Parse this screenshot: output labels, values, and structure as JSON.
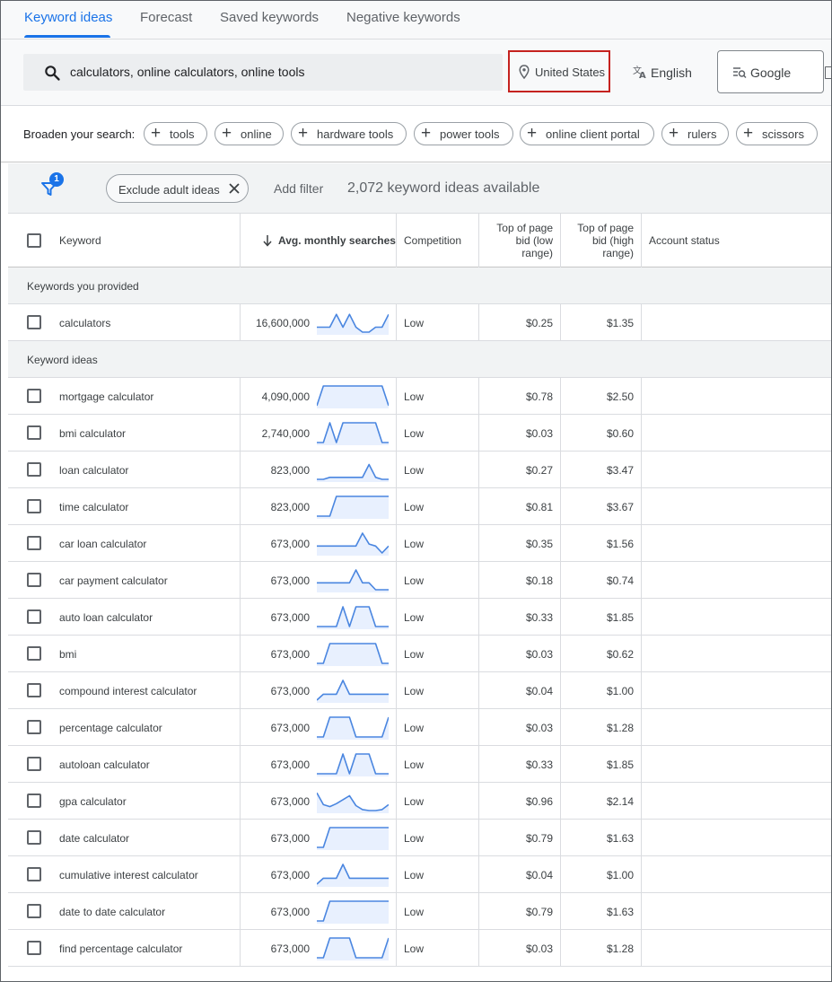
{
  "tabs": [
    {
      "label": "Keyword ideas",
      "active": true
    },
    {
      "label": "Forecast",
      "active": false
    },
    {
      "label": "Saved keywords",
      "active": false
    },
    {
      "label": "Negative keywords",
      "active": false
    }
  ],
  "search": {
    "query": "calculators, online calculators, online tools",
    "location": "United States",
    "language": "English",
    "network": "Google"
  },
  "broaden": {
    "label": "Broaden your search:",
    "chips": [
      "tools",
      "online",
      "hardware tools",
      "power tools",
      "online client portal",
      "rulers",
      "scissors"
    ]
  },
  "filters": {
    "badge_count": "1",
    "adult_chip": "Exclude adult ideas",
    "add_filter": "Add filter",
    "available_text": "2,072 keyword ideas available"
  },
  "columns": {
    "keyword": "Keyword",
    "avg": "Avg. monthly searches",
    "competition": "Competition",
    "bid_low": "Top of page bid (low range)",
    "bid_high": "Top of page bid (high range)",
    "account_status": "Account status"
  },
  "sections": {
    "provided": "Keywords you provided",
    "ideas": "Keyword ideas"
  },
  "provided_rows": [
    {
      "keyword": "calculators",
      "searches": "16,600,000",
      "competition": "Low",
      "low": "$0.25",
      "high": "$1.35",
      "trend": [
        0.25,
        0.25,
        0.25,
        0.9,
        0.25,
        0.9,
        0.25,
        0.0,
        0.0,
        0.25,
        0.25,
        0.9
      ]
    }
  ],
  "idea_rows": [
    {
      "keyword": "mortgage calculator",
      "searches": "4,090,000",
      "competition": "Low",
      "low": "$0.78",
      "high": "$2.50",
      "trend": [
        0,
        1,
        1,
        1,
        1,
        1,
        1,
        1,
        1,
        1,
        1,
        0
      ]
    },
    {
      "keyword": "bmi calculator",
      "searches": "2,740,000",
      "competition": "Low",
      "low": "$0.03",
      "high": "$0.60",
      "trend": [
        0,
        0,
        1,
        0,
        1,
        1,
        1,
        1,
        1,
        1,
        0,
        0
      ]
    },
    {
      "keyword": "loan calculator",
      "searches": "823,000",
      "competition": "Low",
      "low": "$0.27",
      "high": "$3.47",
      "trend": [
        0,
        0,
        0.1,
        0.1,
        0.1,
        0.1,
        0.1,
        0.1,
        0.75,
        0.1,
        0,
        0
      ]
    },
    {
      "keyword": "time calculator",
      "searches": "823,000",
      "competition": "Low",
      "low": "$0.81",
      "high": "$3.67",
      "trend": [
        0,
        0,
        0,
        1,
        1,
        1,
        1,
        1,
        1,
        1,
        1,
        1
      ]
    },
    {
      "keyword": "car loan calculator",
      "searches": "673,000",
      "competition": "Low",
      "low": "$0.35",
      "high": "$1.56",
      "trend": [
        0.35,
        0.35,
        0.35,
        0.35,
        0.35,
        0.35,
        0.35,
        1,
        0.45,
        0.35,
        0,
        0.35
      ]
    },
    {
      "keyword": "car payment calculator",
      "searches": "673,000",
      "competition": "Low",
      "low": "$0.18",
      "high": "$0.74",
      "trend": [
        0.35,
        0.35,
        0.35,
        0.35,
        0.35,
        0.35,
        1,
        0.35,
        0.35,
        0.0,
        0.0,
        0.0
      ]
    },
    {
      "keyword": "auto loan calculator",
      "searches": "673,000",
      "competition": "Low",
      "low": "$0.33",
      "high": "$1.85",
      "trend": [
        0,
        0,
        0,
        0,
        1,
        0,
        1,
        1,
        1,
        0,
        0,
        0
      ]
    },
    {
      "keyword": "bmi",
      "searches": "673,000",
      "competition": "Low",
      "low": "$0.03",
      "high": "$0.62",
      "trend": [
        0,
        0,
        1,
        1,
        1,
        1,
        1,
        1,
        1,
        1,
        0,
        0
      ]
    },
    {
      "keyword": "compound interest calculator",
      "searches": "673,000",
      "competition": "Low",
      "low": "$0.04",
      "high": "$1.00",
      "trend": [
        0,
        0.3,
        0.3,
        0.3,
        1,
        0.3,
        0.3,
        0.3,
        0.3,
        0.3,
        0.3,
        0.3
      ]
    },
    {
      "keyword": "percentage calculator",
      "searches": "673,000",
      "competition": "Low",
      "low": "$0.03",
      "high": "$1.28",
      "trend": [
        0,
        0,
        1,
        1,
        1,
        1,
        0,
        0,
        0,
        0,
        0,
        1
      ]
    },
    {
      "keyword": "autoloan calculator",
      "searches": "673,000",
      "competition": "Low",
      "low": "$0.33",
      "high": "$1.85",
      "trend": [
        0,
        0,
        0,
        0,
        1,
        0,
        1,
        1,
        1,
        0,
        0,
        0
      ]
    },
    {
      "keyword": "gpa calculator",
      "searches": "673,000",
      "competition": "Low",
      "low": "$0.96",
      "high": "$2.14",
      "trend": [
        0.9,
        0.3,
        0.2,
        0.35,
        0.55,
        0.75,
        0.25,
        0.05,
        0.0,
        0.0,
        0.05,
        0.3
      ]
    },
    {
      "keyword": "date calculator",
      "searches": "673,000",
      "competition": "Low",
      "low": "$0.79",
      "high": "$1.63",
      "trend": [
        0,
        0,
        1,
        1,
        1,
        1,
        1,
        1,
        1,
        1,
        1,
        1
      ]
    },
    {
      "keyword": "cumulative interest calculator",
      "searches": "673,000",
      "competition": "Low",
      "low": "$0.04",
      "high": "$1.00",
      "trend": [
        0,
        0.3,
        0.3,
        0.3,
        1,
        0.3,
        0.3,
        0.3,
        0.3,
        0.3,
        0.3,
        0.3
      ]
    },
    {
      "keyword": "date to date calculator",
      "searches": "673,000",
      "competition": "Low",
      "low": "$0.79",
      "high": "$1.63",
      "trend": [
        0,
        0,
        1,
        1,
        1,
        1,
        1,
        1,
        1,
        1,
        1,
        1
      ]
    },
    {
      "keyword": "find percentage calculator",
      "searches": "673,000",
      "competition": "Low",
      "low": "$0.03",
      "high": "$1.28",
      "trend": [
        0,
        0,
        1,
        1,
        1,
        1,
        0,
        0,
        0,
        0,
        0,
        1
      ]
    }
  ],
  "colors": {
    "accent": "#1a73e8",
    "highlight": "#c5221f",
    "spark_line": "#4a86e0",
    "spark_fill": "#e8f0fe"
  }
}
